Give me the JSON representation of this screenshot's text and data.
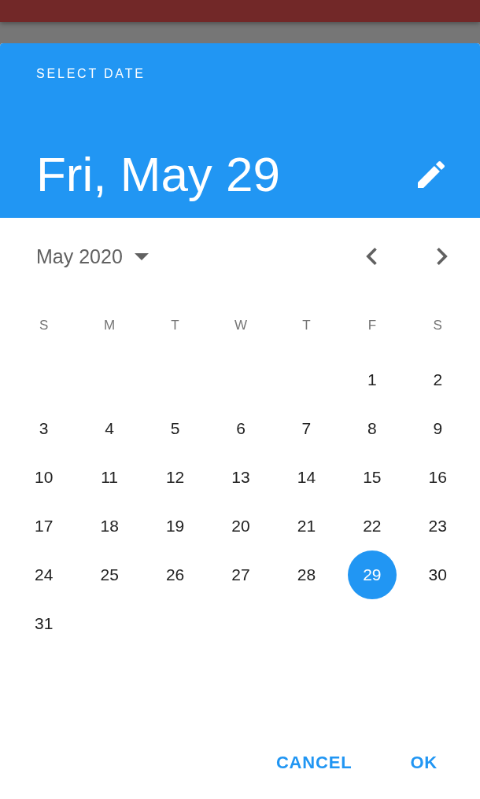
{
  "header": {
    "overline": "SELECT DATE",
    "selected_date": "Fri, May 29"
  },
  "calendar": {
    "month_label": "May 2020",
    "weekdays": [
      "S",
      "M",
      "T",
      "W",
      "T",
      "F",
      "S"
    ],
    "weeks": [
      {
        "days": [
          {
            "label": "1",
            "selected": false
          },
          {
            "label": "2",
            "selected": false
          }
        ]
      },
      {
        "days": [
          {
            "label": "3",
            "selected": false
          },
          {
            "label": "4",
            "selected": false
          },
          {
            "label": "5",
            "selected": false
          },
          {
            "label": "6",
            "selected": false
          },
          {
            "label": "7",
            "selected": false
          },
          {
            "label": "8",
            "selected": false
          },
          {
            "label": "9",
            "selected": false
          }
        ]
      },
      {
        "days": [
          {
            "label": "10",
            "selected": false
          },
          {
            "label": "11",
            "selected": false
          },
          {
            "label": "12",
            "selected": false
          },
          {
            "label": "13",
            "selected": false
          },
          {
            "label": "14",
            "selected": false
          },
          {
            "label": "15",
            "selected": false
          },
          {
            "label": "16",
            "selected": false
          }
        ]
      },
      {
        "days": [
          {
            "label": "17",
            "selected": false
          },
          {
            "label": "18",
            "selected": false
          },
          {
            "label": "19",
            "selected": false
          },
          {
            "label": "20",
            "selected": false
          },
          {
            "label": "21",
            "selected": false
          },
          {
            "label": "22",
            "selected": false
          },
          {
            "label": "23",
            "selected": false
          }
        ]
      },
      {
        "days": [
          {
            "label": "24",
            "selected": false
          },
          {
            "label": "25",
            "selected": false
          },
          {
            "label": "26",
            "selected": false
          },
          {
            "label": "27",
            "selected": false
          },
          {
            "label": "28",
            "selected": false
          },
          {
            "label": "29",
            "selected": true
          },
          {
            "label": "30",
            "selected": false
          }
        ]
      },
      {
        "days": [
          {
            "label": "31",
            "selected": false
          }
        ]
      }
    ]
  },
  "actions": [
    "CANCEL",
    "OK"
  ]
}
